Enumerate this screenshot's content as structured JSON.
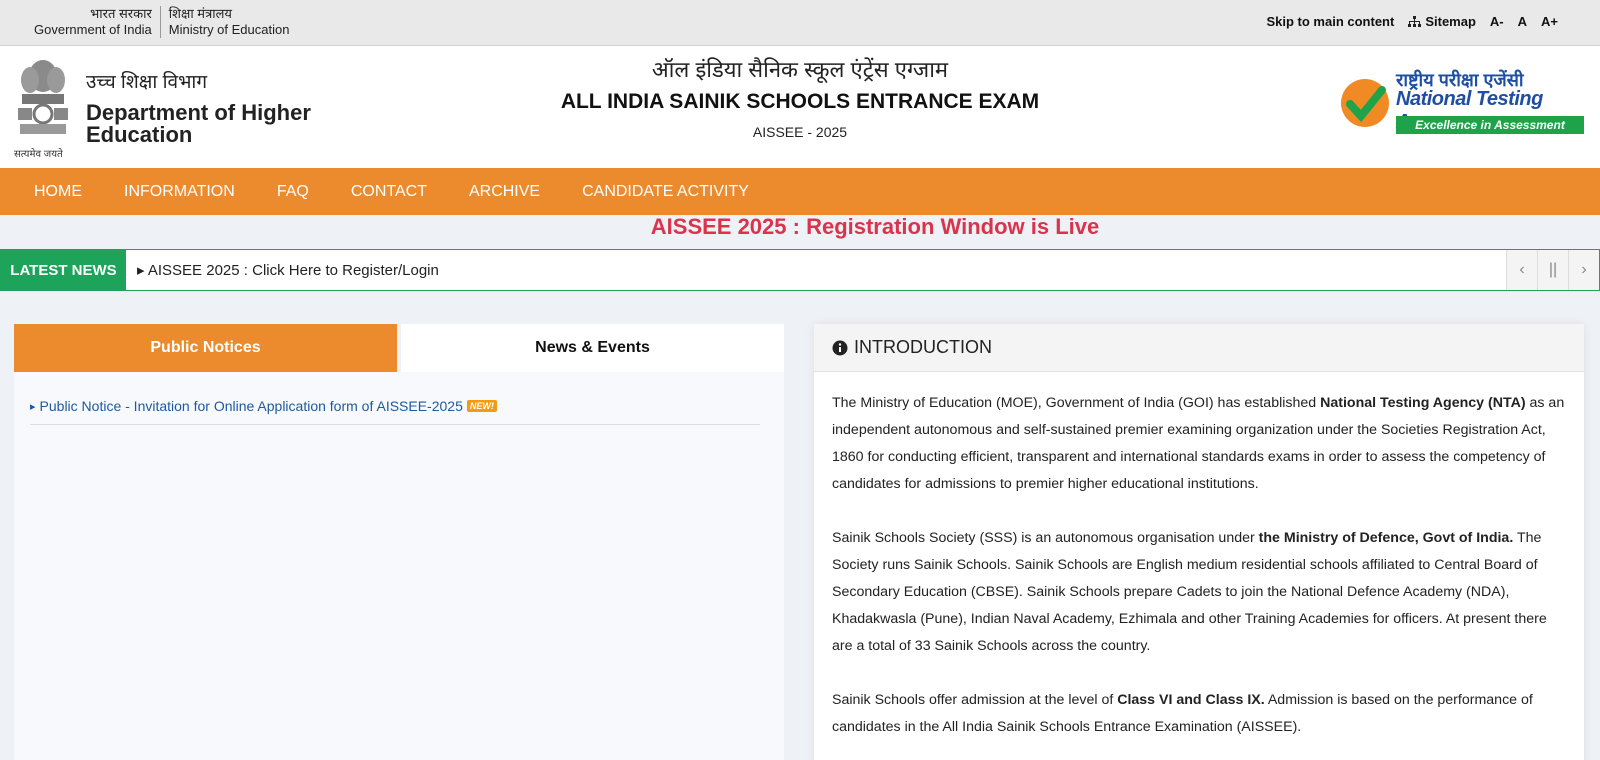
{
  "govbar": {
    "gov_hi": "भारत सरकार",
    "gov_en": "Government of India",
    "ministry_hi": "शिक्षा मंत्रालय",
    "ministry_en": "Ministry of Education",
    "skip_link": "Skip to main content",
    "sitemap": "Sitemap",
    "font_decrease": "A-",
    "font_normal": "A",
    "font_increase": "A+"
  },
  "header": {
    "emblem_motto": "सत्यमेव जयते",
    "dept_hi": "उच्च शिक्षा विभाग",
    "dept_en": "Department of Higher Education",
    "title_hi": "ऑल इंडिया सैनिक स्कूल एंट्रेंस एग्जाम",
    "title_en": "ALL INDIA SAINIK SCHOOLS ENTRANCE EXAM",
    "subtitle": "AISSEE - 2025",
    "nta_hi": "राष्ट्रीय परीक्षा एजेंसी",
    "nta_en": "National Testing Agency",
    "nta_tagline": "Excellence in Assessment"
  },
  "nav": {
    "items": [
      "HOME",
      "INFORMATION",
      "FAQ",
      "CONTACT",
      "ARCHIVE",
      "CANDIDATE ACTIVITY"
    ]
  },
  "headline": "AISSEE 2025 : Registration Window is Live",
  "ticker": {
    "label": "LATEST NEWS",
    "text": "AISSEE 2025 : Click Here to Register/Login"
  },
  "tabs": {
    "public_notices": "Public Notices",
    "news_events": "News & Events"
  },
  "notices": [
    {
      "text": "Public Notice - Invitation for Online Application form of AISSEE-2025",
      "badge": "NEW!"
    }
  ],
  "intro": {
    "heading": "INTRODUCTION",
    "p1_a": "The Ministry of Education (MOE), Government of India (GOI) has established ",
    "p1_b": "National Testing Agency (NTA)",
    "p1_c": " as an independent autonomous and self-sustained premier examining organization under the Societies Registration Act, 1860 for conducting efficient, transparent and international standards exams in order to assess the competency of candidates for admissions to premier higher educational institutions.",
    "p2_a": "Sainik Schools Society (SSS) is an autonomous organisation under ",
    "p2_b": "the Ministry of Defence, Govt of India.",
    "p2_c": " The Society runs Sainik Schools. Sainik Schools are English medium residential schools affiliated to Central Board of Secondary Education (CBSE). Sainik Schools prepare Cadets to join the National Defence Academy (NDA), Khadakwasla (Pune), Indian Naval Academy, Ezhimala and other Training Academies for officers. At present there are a total of 33 Sainik Schools across the country.",
    "p3_a": "Sainik Schools offer admission at the level of ",
    "p3_b": "Class VI and Class IX.",
    "p3_c": " Admission is based on the performance of candidates in the All India Sainik Schools Entrance Examination (AISSEE)."
  },
  "colors": {
    "nav_orange": "#ec8b2e",
    "news_green": "#1ea45a",
    "headline_red": "#d9344c",
    "link_blue": "#1e5aa0"
  }
}
